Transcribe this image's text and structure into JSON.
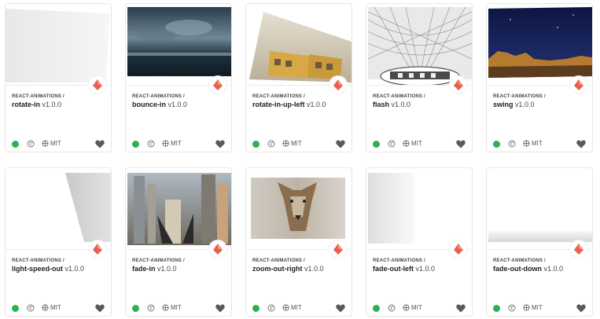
{
  "cards": [
    {
      "scope": "REACT-ANIMATIONS /",
      "name": "rotate-in",
      "version": "v1.0.0",
      "license": "MIT"
    },
    {
      "scope": "REACT-ANIMATIONS /",
      "name": "bounce-in",
      "version": "v1.0.0",
      "license": "MIT"
    },
    {
      "scope": "REACT-ANIMATIONS /",
      "name": "rotate-in-up-left",
      "version": "v1.0.0",
      "license": "MIT"
    },
    {
      "scope": "REACT-ANIMATIONS /",
      "name": "flash",
      "version": "v1.0.0",
      "license": "MIT"
    },
    {
      "scope": "REACT-ANIMATIONS /",
      "name": "swing",
      "version": "v1.0.0",
      "license": "MIT"
    },
    {
      "scope": "REACT-ANIMATIONS /",
      "name": "light-speed-out",
      "version": "v1.0.0",
      "license": "MIT"
    },
    {
      "scope": "REACT-ANIMATIONS /",
      "name": "fade-in",
      "version": "v1.0.0",
      "license": "MIT"
    },
    {
      "scope": "REACT-ANIMATIONS /",
      "name": "zoom-out-right",
      "version": "v1.0.0",
      "license": "MIT"
    },
    {
      "scope": "REACT-ANIMATIONS /",
      "name": "fade-out-left",
      "version": "v1.0.0",
      "license": "MIT"
    },
    {
      "scope": "REACT-ANIMATIONS /",
      "name": "fade-out-down",
      "version": "v1.0.0",
      "license": "MIT"
    }
  ],
  "colors": {
    "status": "#2eb052",
    "logo": "#e8604c",
    "heart": "#5a5a5a"
  }
}
